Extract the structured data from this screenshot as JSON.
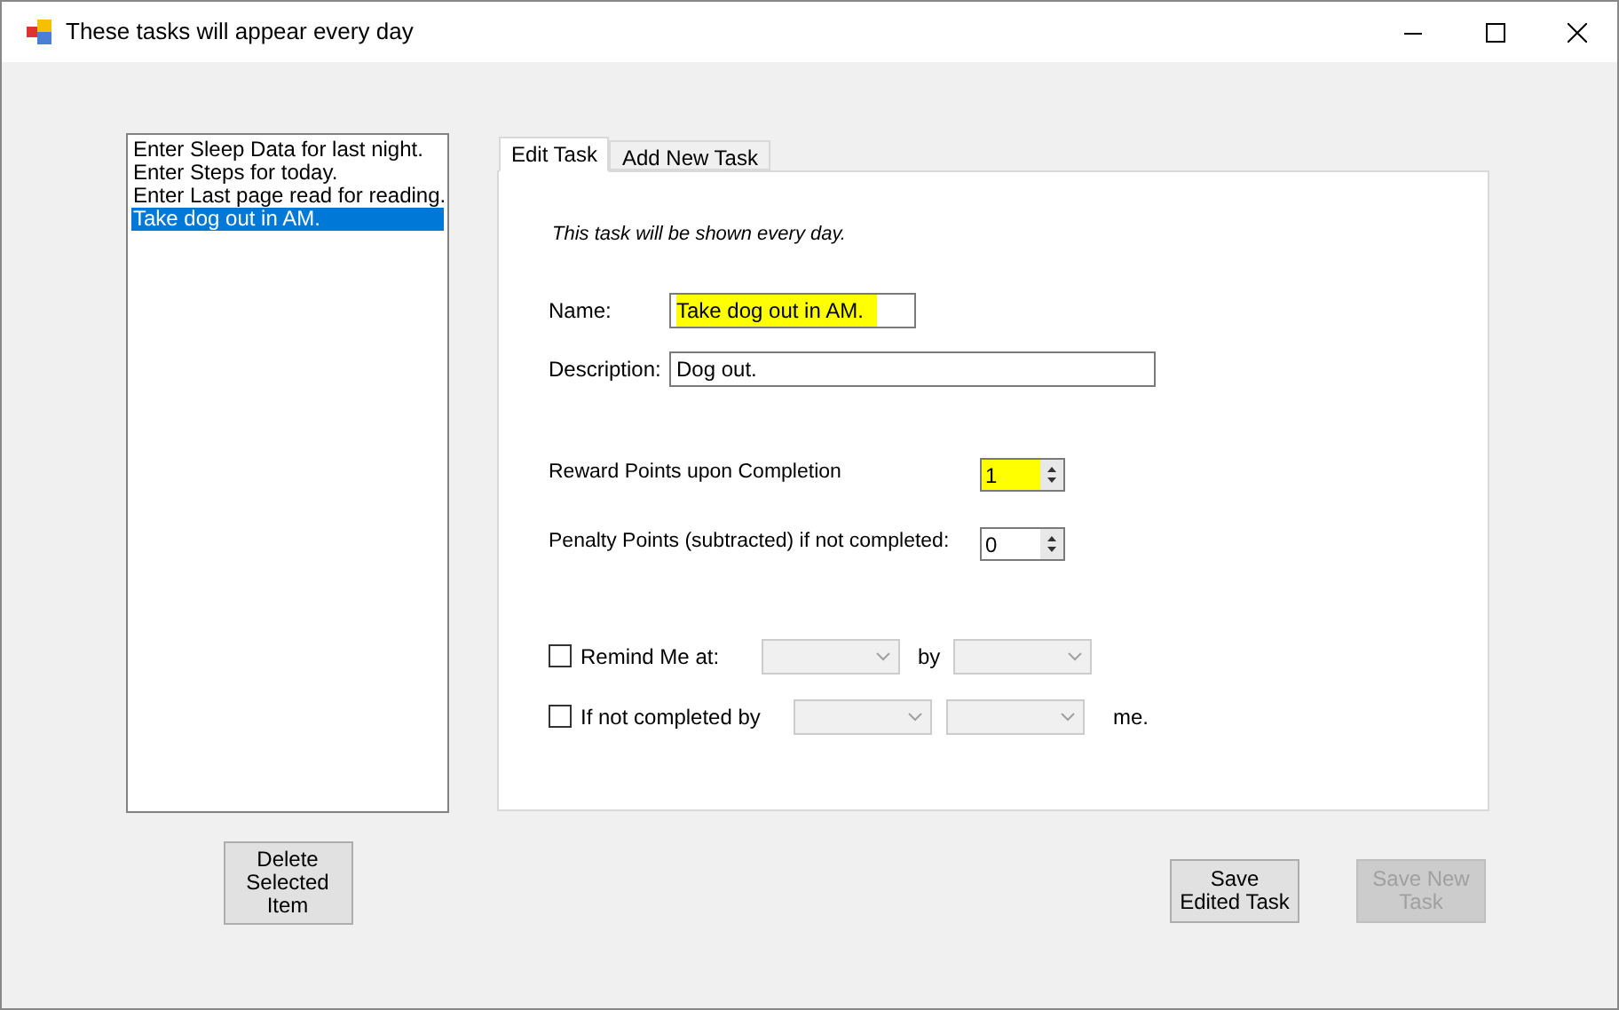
{
  "window": {
    "title": "These tasks will appear every day"
  },
  "task_list": [
    {
      "label": "Enter Sleep Data for last night.",
      "selected": false
    },
    {
      "label": "Enter Steps for today.",
      "selected": false
    },
    {
      "label": "Enter Last page read for reading.",
      "selected": false
    },
    {
      "label": "Take dog out in AM.",
      "selected": true
    }
  ],
  "delete_button": "Delete Selected Item",
  "tabs": [
    {
      "label": "Edit Task",
      "selected": true
    },
    {
      "label": "Add New Task",
      "selected": false
    }
  ],
  "note": "This task will be shown every day.",
  "fields": [
    {
      "label": "Name:",
      "value": "Take dog out in AM.",
      "highlighted": true
    },
    {
      "label": "Description:",
      "value": "Dog out.",
      "highlighted": false
    }
  ],
  "spinners": [
    {
      "label": "Reward Points upon Completion",
      "value": "1",
      "highlighted": true
    },
    {
      "label": "Penalty Points (subtracted) if not completed:",
      "value": "0",
      "highlighted": false
    }
  ],
  "options": [
    {
      "label": "Remind Me at:",
      "checked": false,
      "between": "by"
    },
    {
      "label": "If not completed by",
      "checked": false,
      "after": "me."
    }
  ],
  "buttons": [
    {
      "label": "Save Edited Task",
      "disabled": false
    },
    {
      "label": "Save New Task",
      "disabled": true
    }
  ]
}
